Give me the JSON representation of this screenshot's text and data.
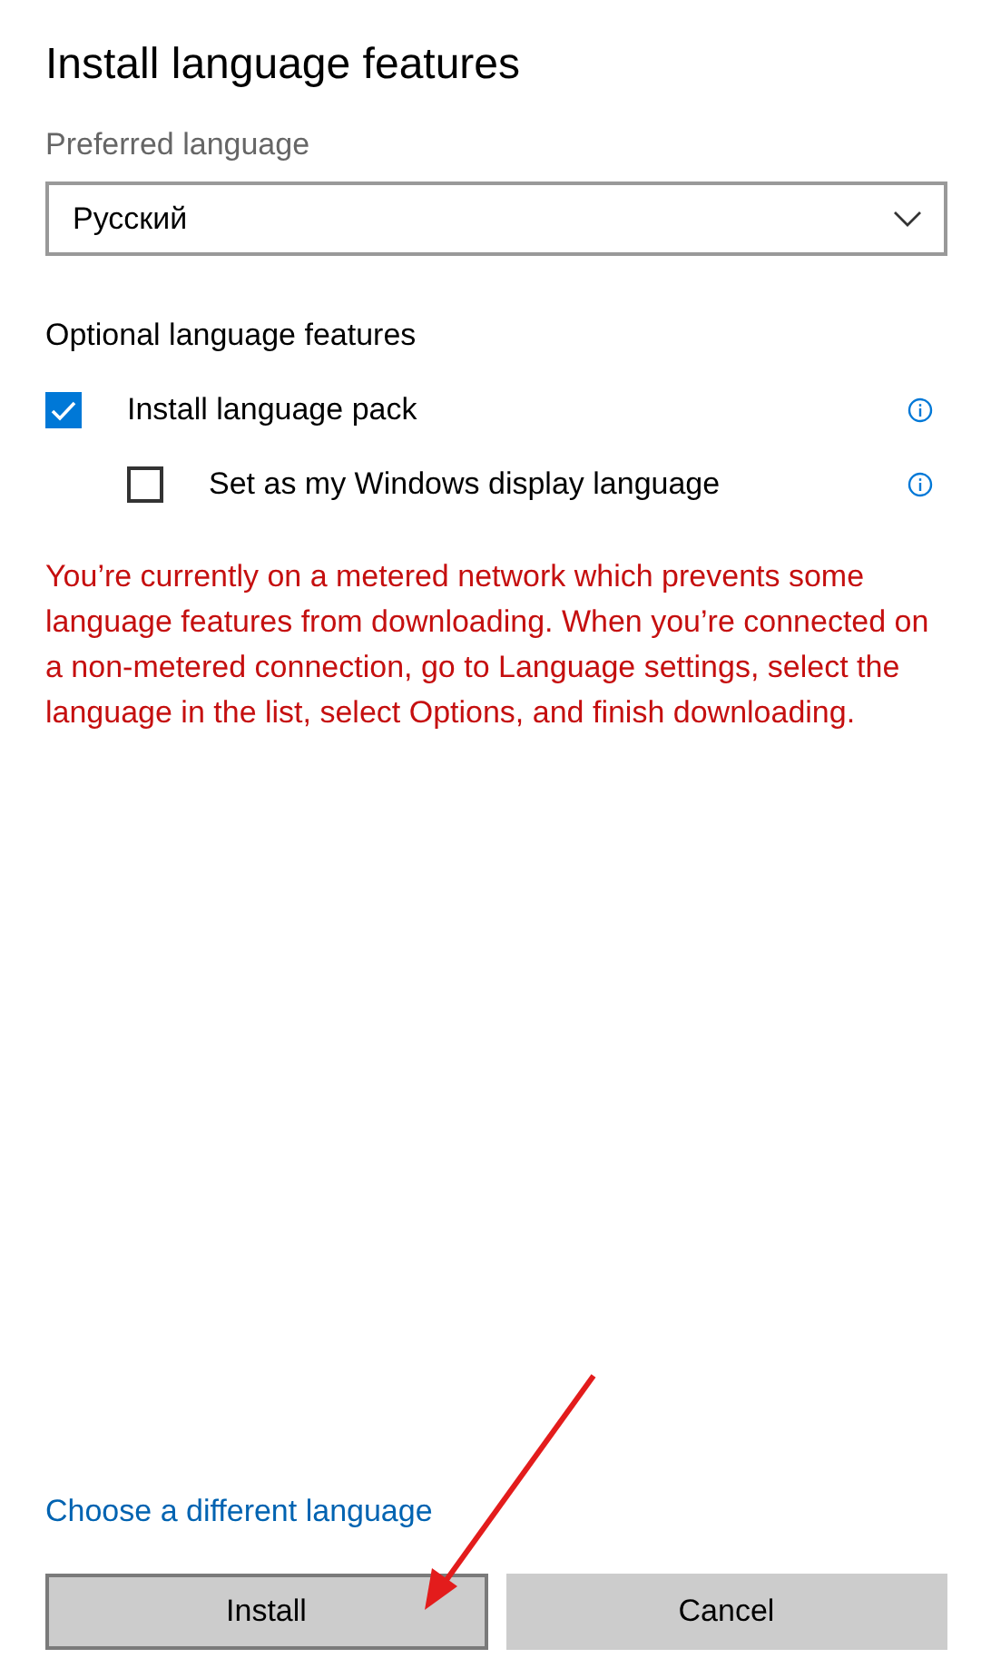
{
  "title": "Install language features",
  "preferred_language": {
    "label": "Preferred language",
    "value": "Русский"
  },
  "optional_features": {
    "heading": "Optional language features",
    "items": [
      {
        "label": "Install language pack",
        "checked": true,
        "children": [
          {
            "label": "Set as my Windows display language",
            "checked": false
          }
        ]
      }
    ]
  },
  "warning": "You’re currently on a metered network which prevents some language features from downloading. When you’re connected on a non-metered connection, go to Language settings, select the language in the list, select Options, and finish downloading.",
  "link": "Choose a different language",
  "buttons": [
    {
      "label": "Install",
      "focused": true
    },
    {
      "label": "Cancel",
      "focused": false
    }
  ]
}
